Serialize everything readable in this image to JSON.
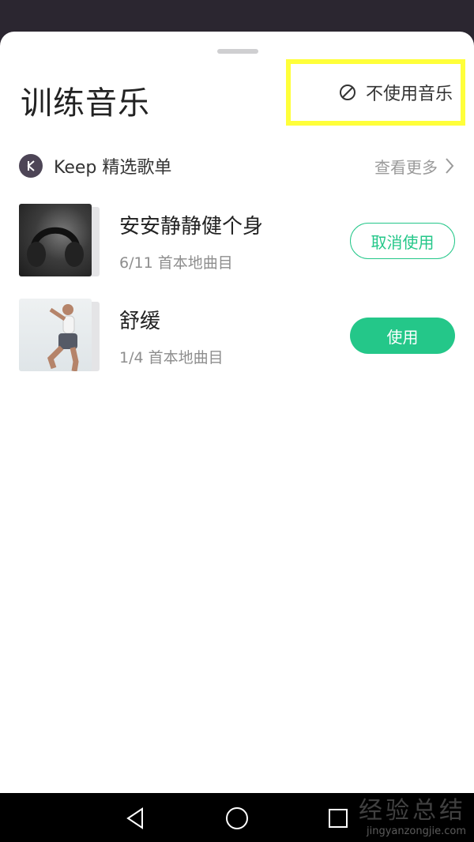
{
  "sheet": {
    "title": "训练音乐",
    "no_music_label": "不使用音乐"
  },
  "section": {
    "brand": "Keep 精选歌单",
    "see_more": "查看更多"
  },
  "playlists": [
    {
      "title": "安安静静健个身",
      "subtitle": "6/11 首本地曲目",
      "button": "取消使用",
      "button_style": "outline"
    },
    {
      "title": "舒缓",
      "subtitle": "1/4 首本地曲目",
      "button": "使用",
      "button_style": "solid"
    }
  ],
  "watermark": {
    "line1": "经验总结",
    "line2": "jingyanzongjie.com"
  },
  "colors": {
    "accent": "#24c789",
    "highlight_box": "#ffff3a",
    "top_bar": "#2b2630"
  }
}
